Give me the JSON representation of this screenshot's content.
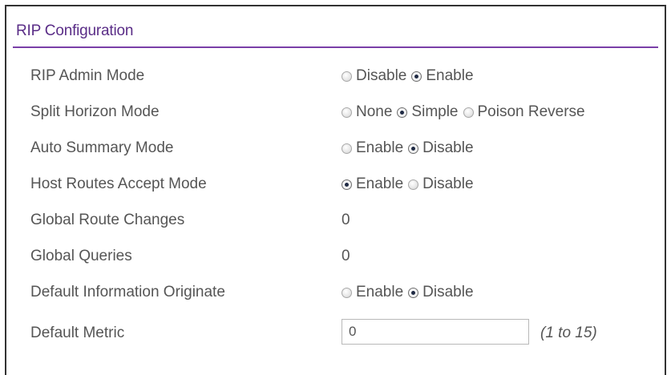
{
  "section_title": "RIP Configuration",
  "rows": [
    {
      "label": "RIP Admin Mode",
      "options": [
        {
          "label": "Disable",
          "checked": false
        },
        {
          "label": "Enable",
          "checked": true
        }
      ]
    },
    {
      "label": "Split Horizon Mode",
      "options": [
        {
          "label": "None",
          "checked": false
        },
        {
          "label": "Simple",
          "checked": true
        },
        {
          "label": "Poison Reverse",
          "checked": false
        }
      ]
    },
    {
      "label": "Auto Summary Mode",
      "options": [
        {
          "label": "Enable",
          "checked": false
        },
        {
          "label": "Disable",
          "checked": true
        }
      ]
    },
    {
      "label": "Host Routes Accept Mode",
      "options": [
        {
          "label": "Enable",
          "checked": true
        },
        {
          "label": "Disable",
          "checked": false
        }
      ]
    },
    {
      "label": "Global Route Changes",
      "value": "0"
    },
    {
      "label": "Global Queries",
      "value": "0"
    },
    {
      "label": "Default Information Originate",
      "options": [
        {
          "label": "Enable",
          "checked": false
        },
        {
          "label": "Disable",
          "checked": true
        }
      ]
    },
    {
      "label": "Default Metric",
      "input_value": "0",
      "hint": "(1 to 15)"
    }
  ]
}
